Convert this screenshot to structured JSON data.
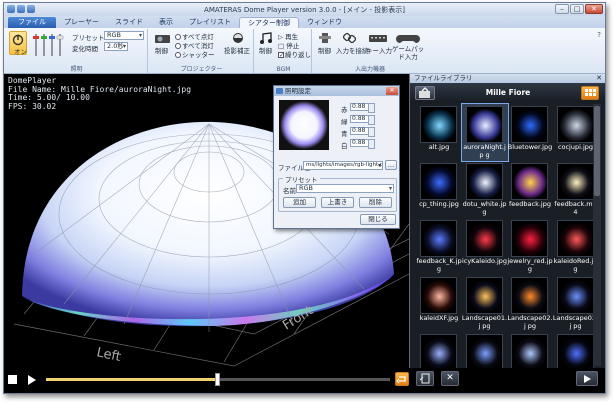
{
  "window": {
    "title": "AMATERAS Dome Player version 3.0.0 - [メイン - 投影表示]"
  },
  "tabs": [
    {
      "label": "ファイル"
    },
    {
      "label": "プレーヤー"
    },
    {
      "label": "スライド"
    },
    {
      "label": "表示"
    },
    {
      "label": "プレイリスト"
    },
    {
      "label": "シアター制御"
    },
    {
      "label": "ウィンドウ"
    }
  ],
  "ribbon": {
    "power_label": "オン",
    "preset_label": "プリセット",
    "preset_value": "RGB",
    "change_time_label": "変化時間",
    "change_time_value": "2.0秒",
    "group_lighting": "照明",
    "projector": {
      "icon_label": "制御",
      "opts": [
        "すべて点灯",
        "すべて消灯",
        "シャッター"
      ],
      "correction_label": "投影補正",
      "group": "プロジェクター"
    },
    "bgm": {
      "icon_label": "制御",
      "opts": [
        "再生",
        "停止",
        "繰り返し"
      ],
      "group": "BGM"
    },
    "input": {
      "control_label": "制御",
      "connect_label": "入力を接続",
      "key_label": "キー入力",
      "gamepad_label": "ゲームパッド入力",
      "group": "入出力機器"
    }
  },
  "viewport": {
    "info_lines": [
      "DomePlayer",
      "File Name: Mille Fiore/auroraNight.jpg",
      "Time:   5.00/  10.00",
      "FPS: 30.02"
    ],
    "labels": {
      "left": "Left",
      "front": "Front"
    }
  },
  "dialog": {
    "title": "照明設定",
    "channels": [
      {
        "label": "赤",
        "value": "0.88"
      },
      {
        "label": "緑",
        "value": "0.88"
      },
      {
        "label": "青",
        "value": "0.88"
      },
      {
        "label": "白",
        "value": "0.88"
      }
    ],
    "file_label": "ファイル名",
    "file_value": "ms/lights/images/rgb-light.png",
    "preset_group": "プリセット",
    "name_label": "名前",
    "name_value": "RGB",
    "add": "追加",
    "overwrite": "上書き",
    "delete": "削除",
    "close": "閉じる"
  },
  "library": {
    "title": "ファイルライブラリ",
    "folder": "Mille Fiore",
    "items": [
      "alt.jpg",
      "auroraNight.jp g",
      "Bluetower.jpg",
      "cocjupi.jpg",
      "cp_thing.jpg",
      "dotu_white.jpg",
      "feedback.jpg",
      "feedback.mp4",
      "feedback_K.jpg",
      "icyKaleido.jpg",
      "jewelry_red.jpg",
      "kaleidoRed.jpg",
      "kaleidXF.jpg",
      "Landscape01.j pg",
      "Landscape02.j pg",
      "Landscape03.j pg",
      "",
      "",
      "",
      ""
    ]
  },
  "playback": {
    "progress": 0.5
  },
  "colors": {
    "accent": "#2a5db0",
    "progress": "#f3d36b",
    "ribbon": "#dfe8f4"
  }
}
